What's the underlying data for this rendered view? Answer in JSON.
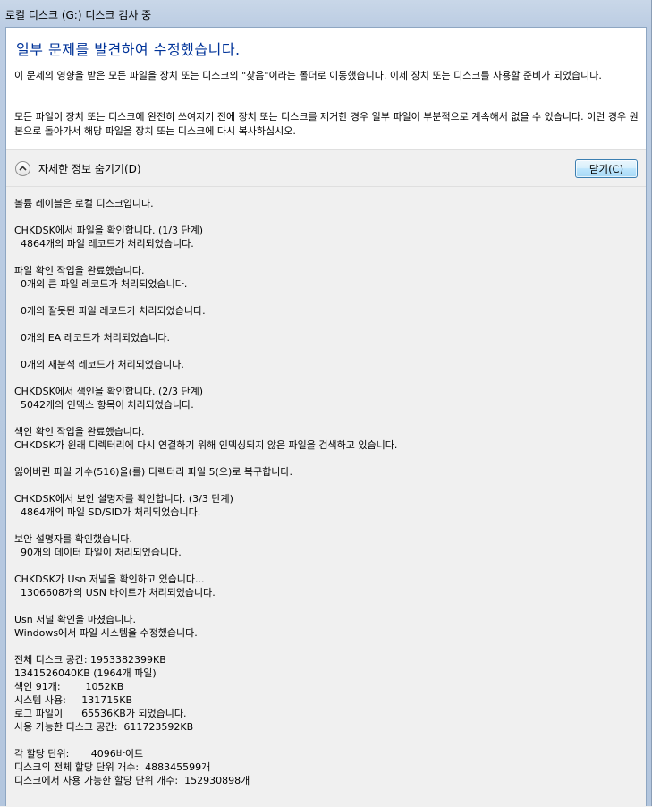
{
  "window": {
    "title": "로컬 디스크 (G:) 디스크 검사 중"
  },
  "main_instruction": "일부 문제를 발견하여 수정했습니다.",
  "description": {
    "line1": "이 문제의 영향을 받은 모든 파일을 장치 또는 디스크의 \"찾음\"이라는 폴더로 이동했습니다. 이제 장치 또는 디스크를 사용할 준비가 되었습니다.",
    "line2": "모든 파일이 장치 또는 디스크에 완전히 쓰여지기 전에 장치 또는 디스크를 제거한 경우 일부 파일이 부분적으로 계속해서 없을 수 있습니다. 이런 경우 원본으로 돌아가서 해당 파일을 장치 또는 디스크에 다시 복사하십시오."
  },
  "expander": {
    "label": "자세한 정보 숨기기(D)",
    "icon": "chevron-up-icon"
  },
  "close_button": {
    "label": "닫기(C)"
  },
  "details": {
    "text": "볼륨 레이블은 로컬 디스크입니다.\n\nCHKDSK에서 파일을 확인합니다. (1/3 단계)\n  4864개의 파일 레코드가 처리되었습니다.\n\n파일 확인 작업을 완료했습니다.\n  0개의 큰 파일 레코드가 처리되었습니다.\n\n  0개의 잘못된 파일 레코드가 처리되었습니다.\n\n  0개의 EA 레코드가 처리되었습니다.\n\n  0개의 재분석 레코드가 처리되었습니다.\n\nCHKDSK에서 색인을 확인합니다. (2/3 단계)\n  5042개의 인덱스 항목이 처리되었습니다.\n\n색인 확인 작업을 완료했습니다.\nCHKDSK가 원래 디렉터리에 다시 연결하기 위해 인덱싱되지 않은 파일을 검색하고 있습니다.\n\n잃어버린 파일 가수(516)을(를) 디렉터리 파일 5(으)로 복구합니다.\n\nCHKDSK에서 보안 설명자를 확인합니다. (3/3 단계)\n  4864개의 파일 SD/SID가 처리되었습니다.\n\n보안 설명자를 확인했습니다.\n  90개의 데이터 파일이 처리되었습니다.\n\nCHKDSK가 Usn 저널을 확인하고 있습니다...\n  1306608개의 USN 바이트가 처리되었습니다.\n\nUsn 저널 확인을 마쳤습니다.\nWindows에서 파일 시스템을 수정했습니다.\n\n전체 디스크 공간: 1953382399KB\n1341526040KB (1964개 파일)\n색인 91개:        1052KB\n시스템 사용:     131715KB\n로그 파일이      65536KB가 되었습니다.\n사용 가능한 디스크 공간:  611723592KB\n\n각 할당 단위:       4096바이트\n디스크의 전체 할당 단위 개수:  488345599개\n디스크에서 사용 가능한 할당 단위 개수:  152930898개"
  }
}
